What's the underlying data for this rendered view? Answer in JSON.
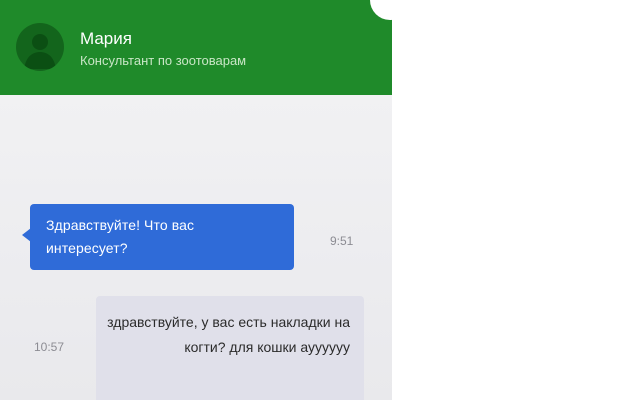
{
  "header": {
    "contact_name": "Мария",
    "contact_role": "Консультант по зоотоварам",
    "background_color": "#1f8a2a",
    "avatar_icon": "person-silhouette-icon"
  },
  "messages": [
    {
      "sender": "agent",
      "text": "Здравствуйте! Что вас интересует?",
      "time": "9:51",
      "bubble_color": "#2f6bd8"
    },
    {
      "sender": "user",
      "text": "здравствуйте, у вас есть накладки на когти? для кошки ауууууу",
      "time": "10:57",
      "bubble_color": "#e0e0ea"
    }
  ]
}
